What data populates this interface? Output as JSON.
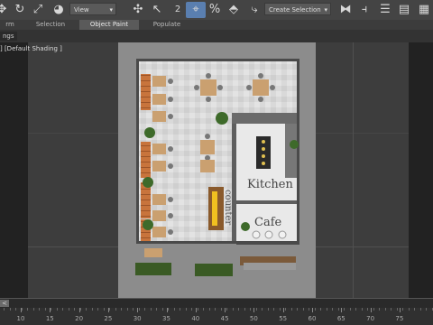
{
  "toolbar": {
    "view_dropdown": "View",
    "selection_set_dropdown": "Create Selection Set",
    "snap_label": "2",
    "percent_label": "%"
  },
  "tabs": [
    {
      "label": "rm",
      "active": false
    },
    {
      "label": "Selection",
      "active": false
    },
    {
      "label": "Object Paint",
      "active": true
    },
    {
      "label": "Populate",
      "active": false
    }
  ],
  "ribbon": {
    "label": "ngs"
  },
  "viewport": {
    "label": "] [Default Shading ]",
    "plan": {
      "kitchen_label": "Kitchen",
      "counter_label": "counter",
      "cafe_label": "Cafe"
    }
  },
  "timeslider": {
    "handle": "<"
  },
  "ruler": {
    "ticks": [
      "10",
      "15",
      "20",
      "25",
      "30",
      "35",
      "40",
      "45",
      "50",
      "55",
      "60",
      "65",
      "70",
      "75"
    ]
  },
  "colors": {
    "accent": "#5aa0e0",
    "viewport_bg": "#3d3d3d",
    "floor": "#d8d8d8",
    "wood": "#c0703a"
  }
}
